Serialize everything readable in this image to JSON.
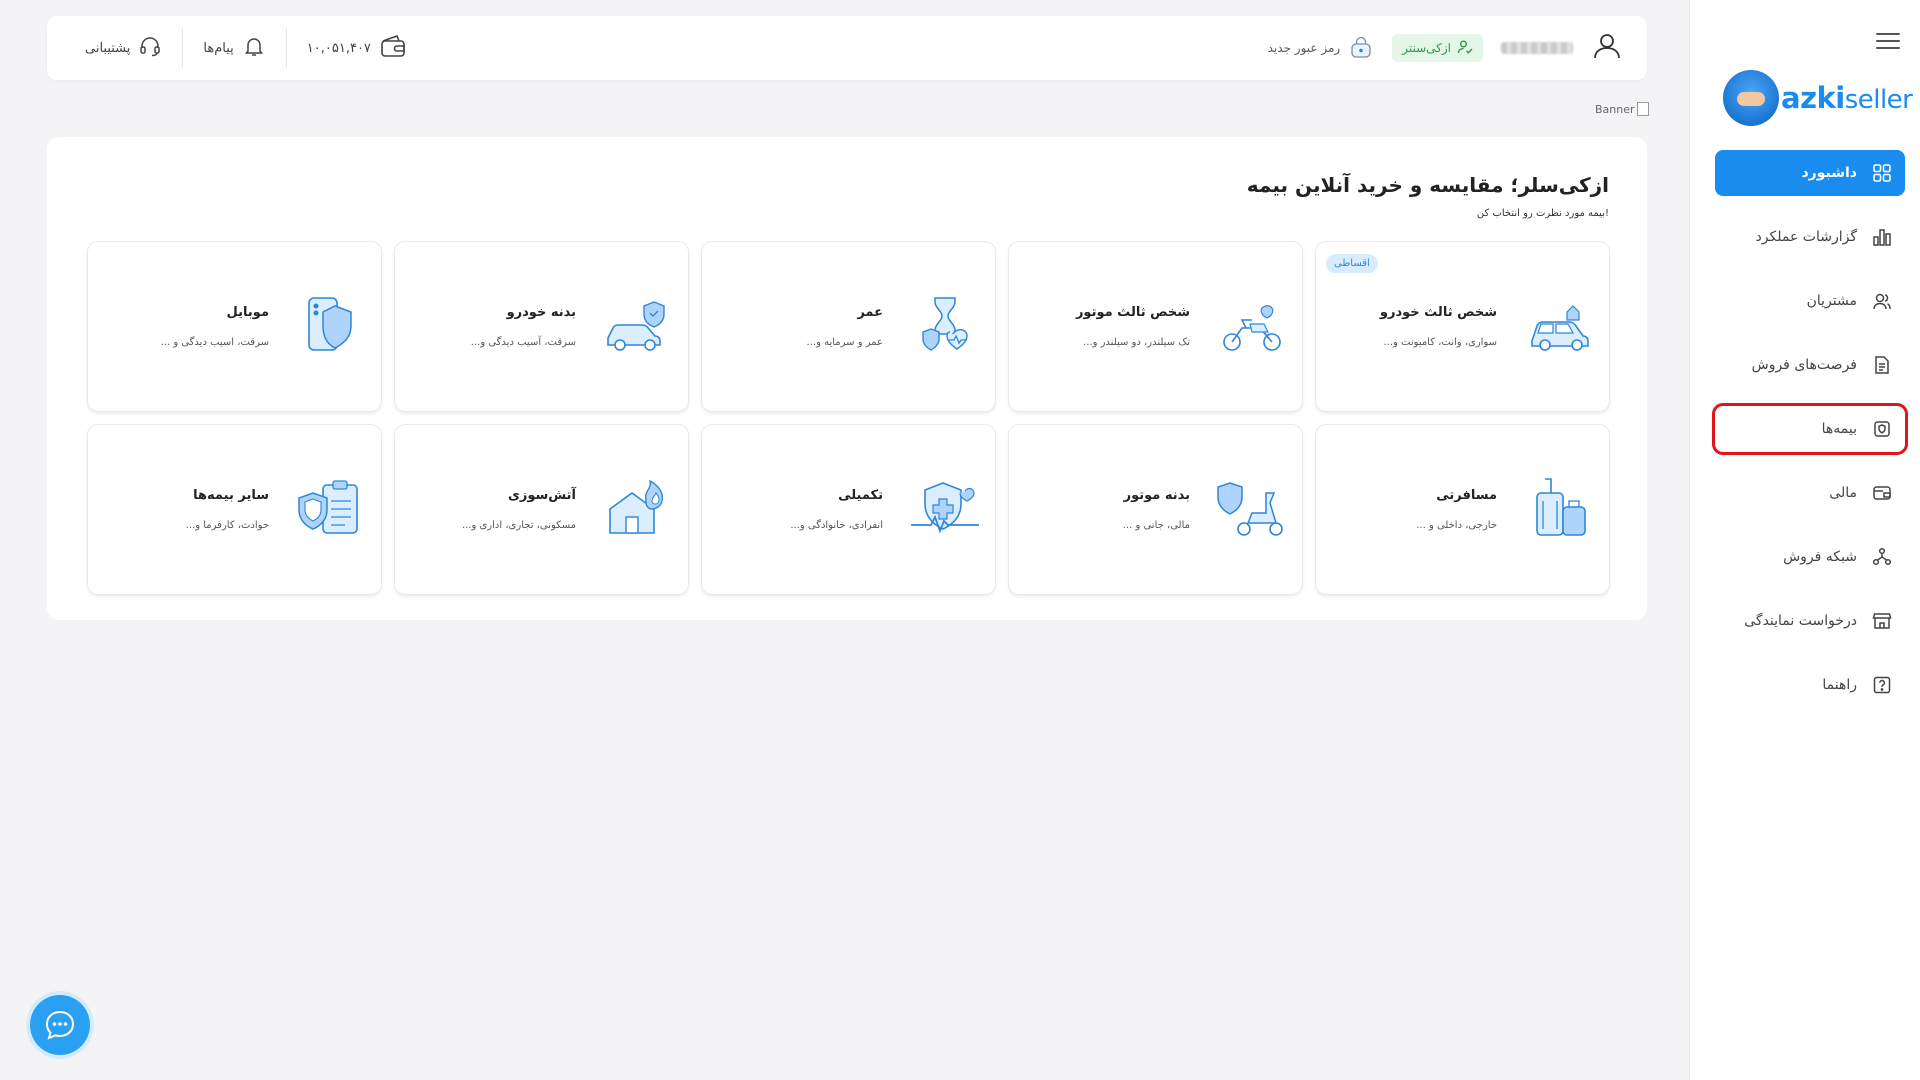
{
  "sidebar": {
    "logo": {
      "text_bold": "azki",
      "text_light": "seller"
    },
    "items": [
      {
        "label": "داشبورد",
        "icon": "dashboard-icon",
        "active": true
      },
      {
        "label": "گزارشات عملکرد",
        "icon": "chart-icon"
      },
      {
        "label": "مشتریان",
        "icon": "users-icon"
      },
      {
        "label": "فرصت‌های فروش",
        "icon": "document-icon"
      },
      {
        "label": "بیمه‌ها",
        "icon": "insurance-icon",
        "highlighted": true
      },
      {
        "label": "مالی",
        "icon": "wallet-icon"
      },
      {
        "label": "شبکه فروش",
        "icon": "network-icon"
      },
      {
        "label": "درخواست نمایندگی",
        "icon": "store-icon"
      },
      {
        "label": "راهنما",
        "icon": "help-icon"
      }
    ]
  },
  "topbar": {
    "support_label": "پشتیبانی",
    "messages_label": "پیام‌ها",
    "wallet_balance": "۱۰,۰۵۱,۴۰۷",
    "new_password_label": "رمز عبور جدید",
    "azki_center_label": "ازکی‌سنتر"
  },
  "banner_alt": "Banner",
  "main": {
    "title": "ازکی‌سلر؛ مقایسه و خرید آنلاین بیمه",
    "subtitle": "بیمه مورد نظرت رو انتخاب کن!",
    "cards": [
      {
        "title": "شخص ثالث خودرو",
        "desc": "سواری، وانت، کامیونت و...",
        "badge": "اقساطی",
        "icon": "car-icon"
      },
      {
        "title": "شخص ثالث موتور",
        "desc": "تک سیلندر، دو سیلندر و...",
        "icon": "motorcycle-icon"
      },
      {
        "title": "عمر",
        "desc": "عمر و سرمایه و...",
        "icon": "life-icon"
      },
      {
        "title": "بدنه خودرو",
        "desc": "سرقت، آسیب دیدگی و...",
        "icon": "car-shield-icon"
      },
      {
        "title": "موبایل",
        "desc": "سرقت، اسیب دیدگی و ...",
        "icon": "phone-icon"
      },
      {
        "title": "مسافرتی",
        "desc": "خارجی، داخلی و ...",
        "icon": "luggage-icon"
      },
      {
        "title": "بدنه موتور",
        "desc": "مالی، جانی و ...",
        "icon": "scooter-shield-icon"
      },
      {
        "title": "تکمیلی",
        "desc": "انفرادی، خانوادگی و...",
        "icon": "health-icon"
      },
      {
        "title": "آتش‌سوزی",
        "desc": "مسکونی، تجاری، اداری و...",
        "icon": "fire-house-icon"
      },
      {
        "title": "سایر بیمه‌ها",
        "desc": "حوادث، کارفرما و...",
        "icon": "clipboard-shield-icon"
      }
    ]
  },
  "colors": {
    "primary": "#1a8bef",
    "highlight_border": "#e0151b",
    "green": "#2e9a47"
  }
}
